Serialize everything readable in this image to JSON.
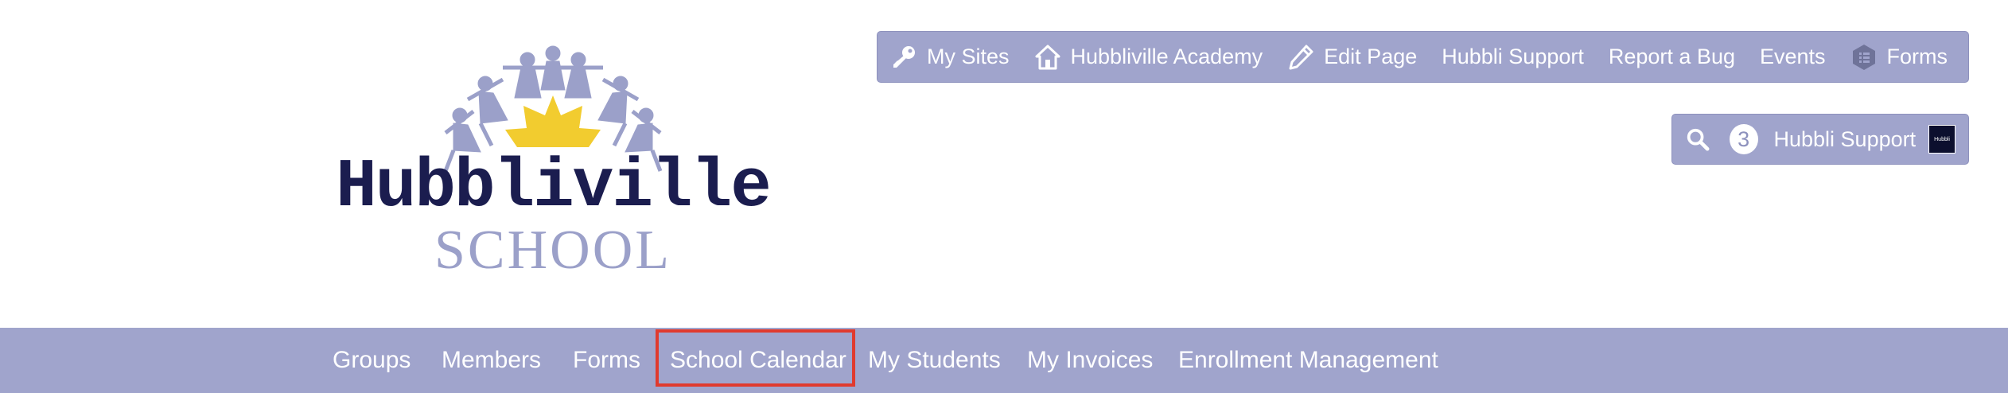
{
  "logo": {
    "title": "Hubbliville",
    "subtitle": "SCHOOL",
    "colors": {
      "figures": "#9ba0c9",
      "sun": "#f2cc2f",
      "title": "#1b1d4f"
    }
  },
  "admin_bar": {
    "items": [
      {
        "label": "My Sites",
        "icon": "key-icon"
      },
      {
        "label": "Hubbliville Academy",
        "icon": "home-icon"
      },
      {
        "label": "Edit Page",
        "icon": "pencil-icon"
      },
      {
        "label": "Hubbli Support"
      },
      {
        "label": "Report a Bug"
      },
      {
        "label": "Events"
      },
      {
        "label": "Forms",
        "icon": "forms-hexagon-icon"
      }
    ]
  },
  "user_bar": {
    "search_icon": "search-icon",
    "notification_count": "3",
    "label": "Hubbli Support",
    "thumbnail_text": "Hubbli"
  },
  "main_nav": {
    "items": [
      "Groups",
      "Members",
      "Forms",
      "School Calendar",
      "My Students",
      "My Invoices",
      "Enrollment Management"
    ],
    "active": "School Calendar"
  },
  "colors": {
    "bar_bg": "#a0a4cc",
    "highlight": "#e03a2e"
  }
}
